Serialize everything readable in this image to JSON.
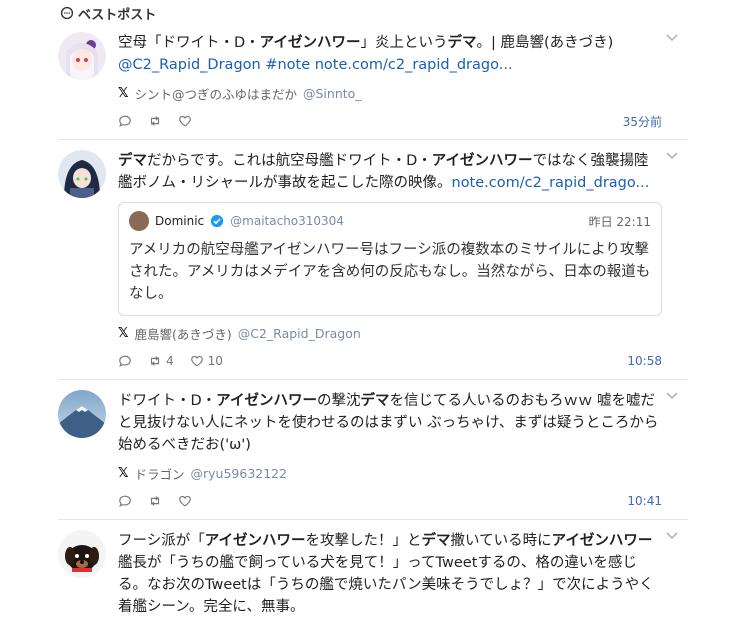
{
  "header": {
    "title": "ベストポスト"
  },
  "posts": [
    {
      "text_parts": {
        "p1": "空母「ドワイト・D・",
        "b1": "アイゼンハワー",
        "p2": "」炎上という",
        "b2": "デマ",
        "p3": "。| 鹿島響(あきづき)",
        "link": "@C2_Rapid_Dragon #note note.com/c2_rapid_drago..."
      },
      "source_name": "シント@つぎのふゆはまだか",
      "source_handle": "@Sinnto_",
      "time": "35分前"
    },
    {
      "text_parts": {
        "b1": "デマ",
        "p1": "だからです。これは航空母艦ドワイト・D・",
        "b2": "アイゼンハワー",
        "p2": "ではなく強襲揚陸艦ボノム・リシャールが事故を起こした際の映像。",
        "link": "note.com/c2_rapid_drago..."
      },
      "quote": {
        "name": "Dominic",
        "handle": "@maitacho310304",
        "time": "昨日 22:11",
        "text": "アメリカの航空母艦アイゼンハワー号はフーシ派の複数本のミサイルにより攻撃された。アメリカはメデイアを含め何の反応もなし。当然ながら、日本の報道もなし。"
      },
      "source_name": "鹿島響(あきづき)",
      "source_handle": "@C2_Rapid_Dragon",
      "retweets": "4",
      "likes": "10",
      "time": "10:58"
    },
    {
      "text_parts": {
        "p1": "ドワイト・D・",
        "b1": "アイゼンハワー",
        "p2": "の撃沈",
        "b2": "デマ",
        "p3": "を信じてる人いるのおもろｗｗ 嘘を嘘だと見抜けない人にネットを使わせるのはまずい ぶっちゃけ、まずは疑うところから始めるべきだお('ω')"
      },
      "source_name": "ドラゴン",
      "source_handle": "@ryu59632122",
      "time": "10:41"
    },
    {
      "text_parts": {
        "p1": "フーシ派が「",
        "b1": "アイゼンハワー",
        "p2": "を攻撃した！」と",
        "b2": "デマ",
        "p3": "撒いている時に",
        "b3": "アイゼンハワー",
        "p4": "艦長が「うちの艦で飼っている犬を見て！」ってTweetするの、格の違いを感じる。なお次のTweetは「うちの艦で焼いたパン美味そうでしょ？」で次にようやく着艦シーン。完全に、無事。"
      }
    }
  ]
}
